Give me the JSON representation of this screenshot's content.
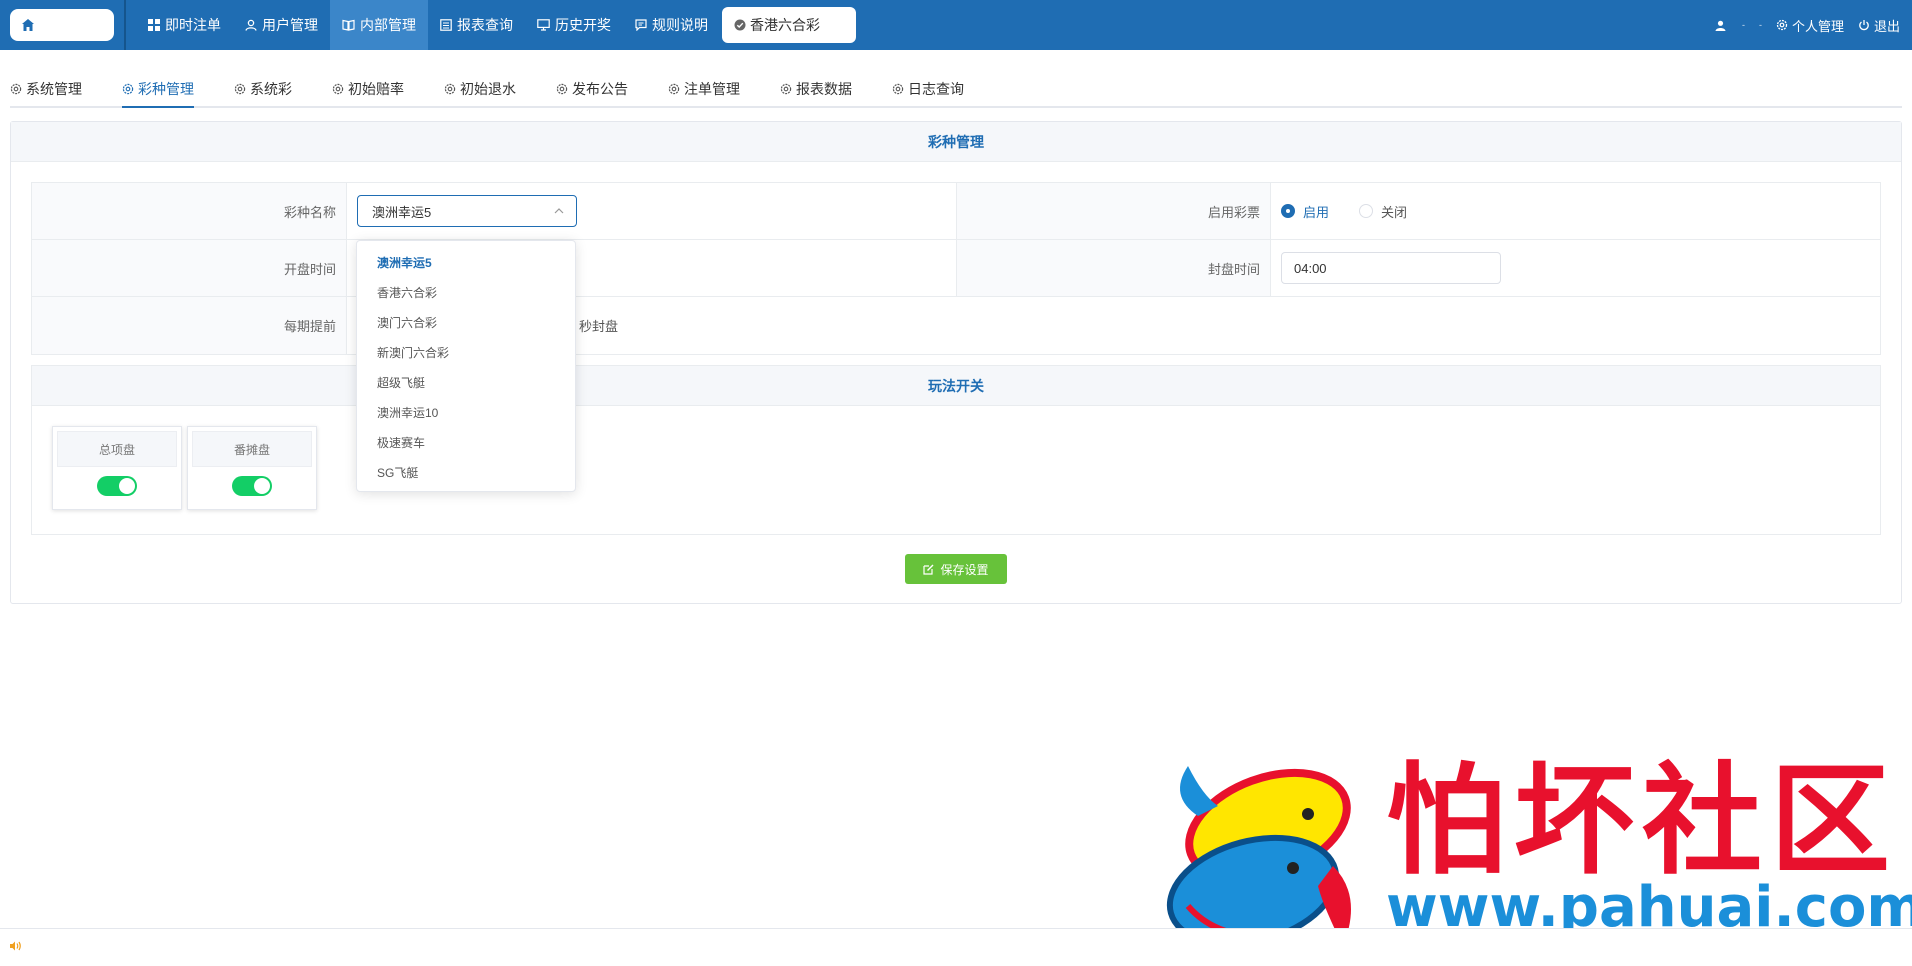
{
  "topbar": {
    "nav": [
      {
        "label": "即时注单",
        "icon": "grid-icon"
      },
      {
        "label": "用户管理",
        "icon": "user-icon"
      },
      {
        "label": "内部管理",
        "icon": "book-icon"
      },
      {
        "label": "报表查询",
        "icon": "report-icon"
      },
      {
        "label": "历史开奖",
        "icon": "monitor-icon"
      },
      {
        "label": "规则说明",
        "icon": "message-icon"
      }
    ],
    "active_nav": "内部管理",
    "lottery": "香港六合彩",
    "right": {
      "dot1": "-",
      "dot2": "-",
      "profile": "个人管理",
      "logout": "退出"
    }
  },
  "subtabs": [
    {
      "label": "系统管理"
    },
    {
      "label": "彩种管理"
    },
    {
      "label": "系统彩"
    },
    {
      "label": "初始赔率"
    },
    {
      "label": "初始退水"
    },
    {
      "label": "发布公告"
    },
    {
      "label": "注单管理"
    },
    {
      "label": "报表数据"
    },
    {
      "label": "日志查询"
    }
  ],
  "active_subtab": "彩种管理",
  "panel": {
    "title": "彩种管理",
    "form": {
      "name_label": "彩种名称",
      "name_value": "澳洲幸运5",
      "enable_label": "启用彩票",
      "enable_on": "启用",
      "enable_off": "关闭",
      "open_label": "开盘时间",
      "close_label": "封盘时间",
      "close_value": "04:00",
      "advance_label": "每期提前",
      "advance_suffix": "秒封盘"
    },
    "play": {
      "title": "玩法开关",
      "cards": [
        {
          "label": "总项盘",
          "on": true
        },
        {
          "label": "番摊盘",
          "on": true
        }
      ]
    },
    "save_label": "保存设置"
  },
  "dropdown": {
    "options": [
      "澳洲幸运5",
      "香港六合彩",
      "澳门六合彩",
      "新澳门六合彩",
      "超级飞艇",
      "澳洲幸运10",
      "极速赛车",
      "SG飞艇"
    ],
    "selected": "澳洲幸运5"
  },
  "watermark": {
    "text": "怕坏社区",
    "url": "www.pahuai.com"
  },
  "colors": {
    "primary": "#1f6db3",
    "success": "#67c23a",
    "switch_on": "#13ce66",
    "watermark_red": "#e8112d",
    "watermark_blue": "#1b8fd9"
  }
}
